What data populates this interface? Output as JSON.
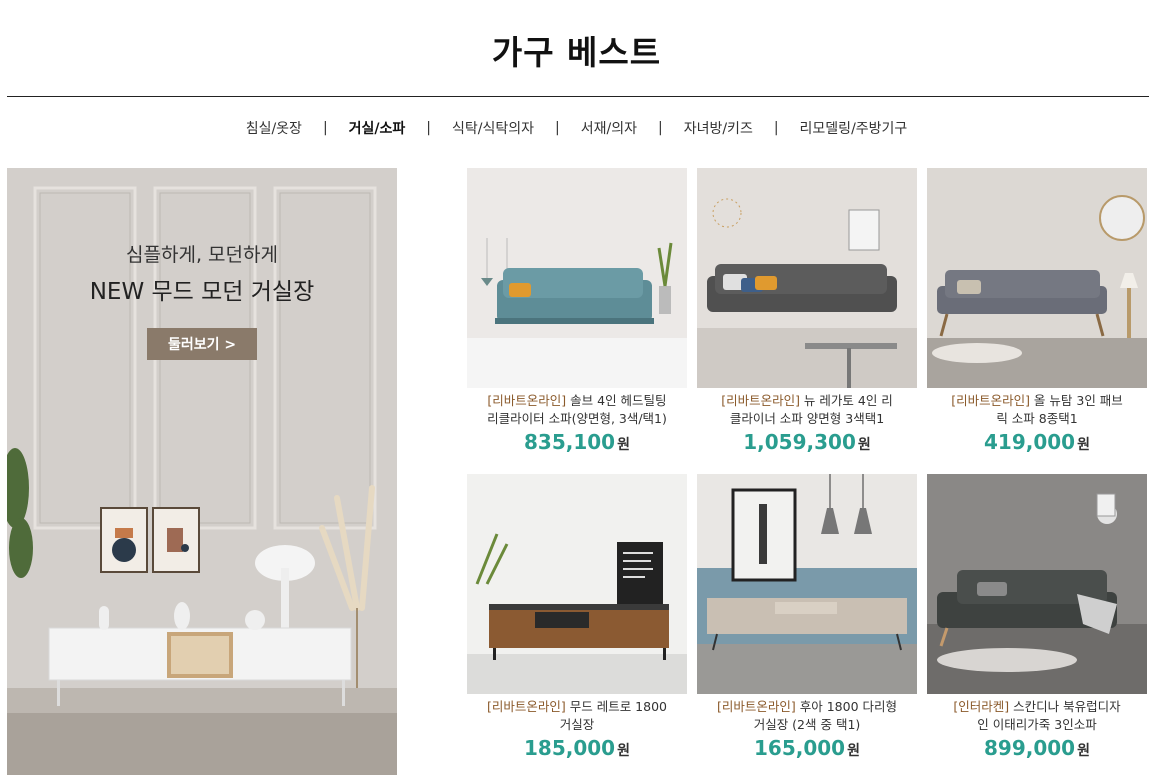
{
  "page": {
    "title": "가구 베스트"
  },
  "categories": [
    {
      "label": "침실/옷장",
      "active": false
    },
    {
      "label": "거실/소파",
      "active": true
    },
    {
      "label": "식탁/식탁의자",
      "active": false
    },
    {
      "label": "서재/의자",
      "active": false
    },
    {
      "label": "자녀방/키즈",
      "active": false
    },
    {
      "label": "리모델링/주방기구",
      "active": false
    }
  ],
  "separator": "|",
  "banner": {
    "subtitle": "심플하게, 모던하게",
    "headline": "NEW 무드 모던 거실장",
    "button_label": "둘러보기 >"
  },
  "currency_label": "원",
  "products": [
    {
      "brand": "[리바트온라인]",
      "name_line1": " 솔브 4인 헤드틸팅",
      "name_line2": "리클라이터 소파(양면형, 3색/택1)",
      "price": "835,100"
    },
    {
      "brand": "[리바트온라인]",
      "name_line1": " 뉴 레가토 4인 리",
      "name_line2": "클라이너 소파 양면형 3색택1",
      "price": "1,059,300"
    },
    {
      "brand": "[리바트온라인]",
      "name_line1": " 올 뉴탐 3인 패브",
      "name_line2": "릭 소파 8종택1",
      "price": "419,000"
    },
    {
      "brand": "[리바트온라인]",
      "name_line1": " 무드 레트로 1800",
      "name_line2": "거실장",
      "price": "185,000"
    },
    {
      "brand": "[리바트온라인]",
      "name_line1": " 후아 1800 다리형",
      "name_line2": "거실장 (2색 중 택1)",
      "price": "165,000"
    },
    {
      "brand": "[인터라켄]",
      "name_line1": " 스칸디나 북유럽디자",
      "name_line2": "인 이태리가죽 3인소파",
      "price": "899,000"
    }
  ],
  "colors": {
    "price": "#2a9d8f",
    "brand": "#8b5a2b",
    "banner_button": "#8a7a6a"
  }
}
